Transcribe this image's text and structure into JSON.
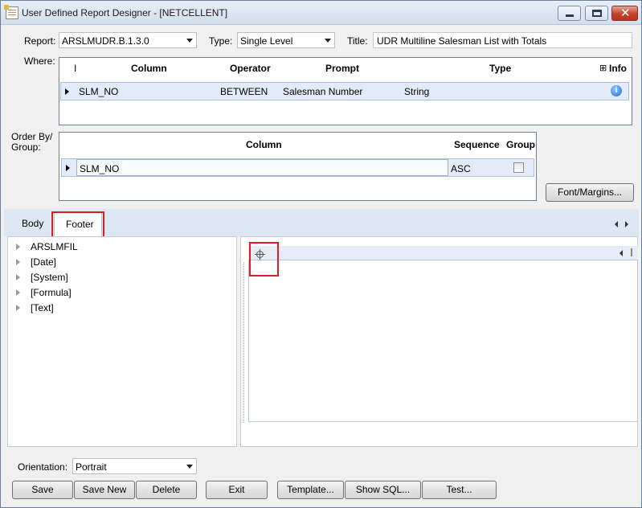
{
  "window": {
    "title": "User Defined Report Designer - [NETCELLENT]"
  },
  "report": {
    "report_label": "Report:",
    "report_value": "ARSLMUDR.B.1.3.0",
    "type_label": "Type:",
    "type_value": "Single Level",
    "title_label": "Title:",
    "title_value": "UDR Multiline Salesman List with Totals"
  },
  "where": {
    "label": "Where:",
    "columns": [
      "I",
      "Column",
      "Operator",
      "Prompt",
      "Type",
      "Info"
    ],
    "rows": [
      {
        "column": "SLM_NO",
        "operator": "BETWEEN",
        "prompt": "Salesman Number",
        "type": "String"
      }
    ]
  },
  "order_by": {
    "label": "Order By/ Group:",
    "columns": [
      "Column",
      "Sequence",
      "Group"
    ],
    "rows": [
      {
        "column": "SLM_NO",
        "sequence": "ASC",
        "group": false
      }
    ],
    "font_button": "Font/Margins..."
  },
  "tabs": [
    {
      "label": "Body",
      "active": false
    },
    {
      "label": "Footer",
      "active": true
    }
  ],
  "tree": {
    "items": [
      "ARSLMFIL",
      "[Date]",
      "[System]",
      "[Formula]",
      "[Text]"
    ]
  },
  "bottom": {
    "orientation_label": "Orientation:",
    "orientation_value": "Portrait",
    "buttons": [
      "Save",
      "Save New",
      "Delete",
      "Exit",
      "Template...",
      "Show SQL...",
      "Test..."
    ]
  }
}
